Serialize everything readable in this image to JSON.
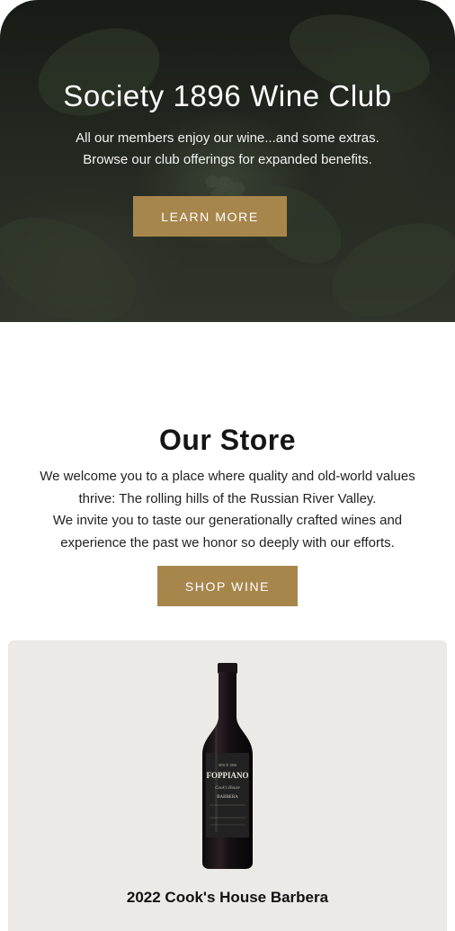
{
  "hero": {
    "title": "Society 1896 Wine Club",
    "subtitle_line1": "All our members enjoy our wine...and some extras.",
    "subtitle_line2": "Browse our club offerings for expanded benefits.",
    "button_label": "LEARN MORE"
  },
  "store": {
    "title": "Our Store",
    "desc_line1": "We welcome you to a place where quality and old-world values",
    "desc_line2": "thrive: The rolling hills of the Russian River Valley.",
    "desc_line3": "We invite you to taste our generationally crafted wines and",
    "desc_line4": "experience the past we honor so deeply with our efforts.",
    "button_label": "SHOP WINE"
  },
  "product": {
    "name": "2022 Cook's House Barbera",
    "label_brand": "FOPPIANO",
    "label_varietal": "BARBERA"
  },
  "colors": {
    "accent": "#a7864c",
    "card_bg": "#ebeae6"
  }
}
